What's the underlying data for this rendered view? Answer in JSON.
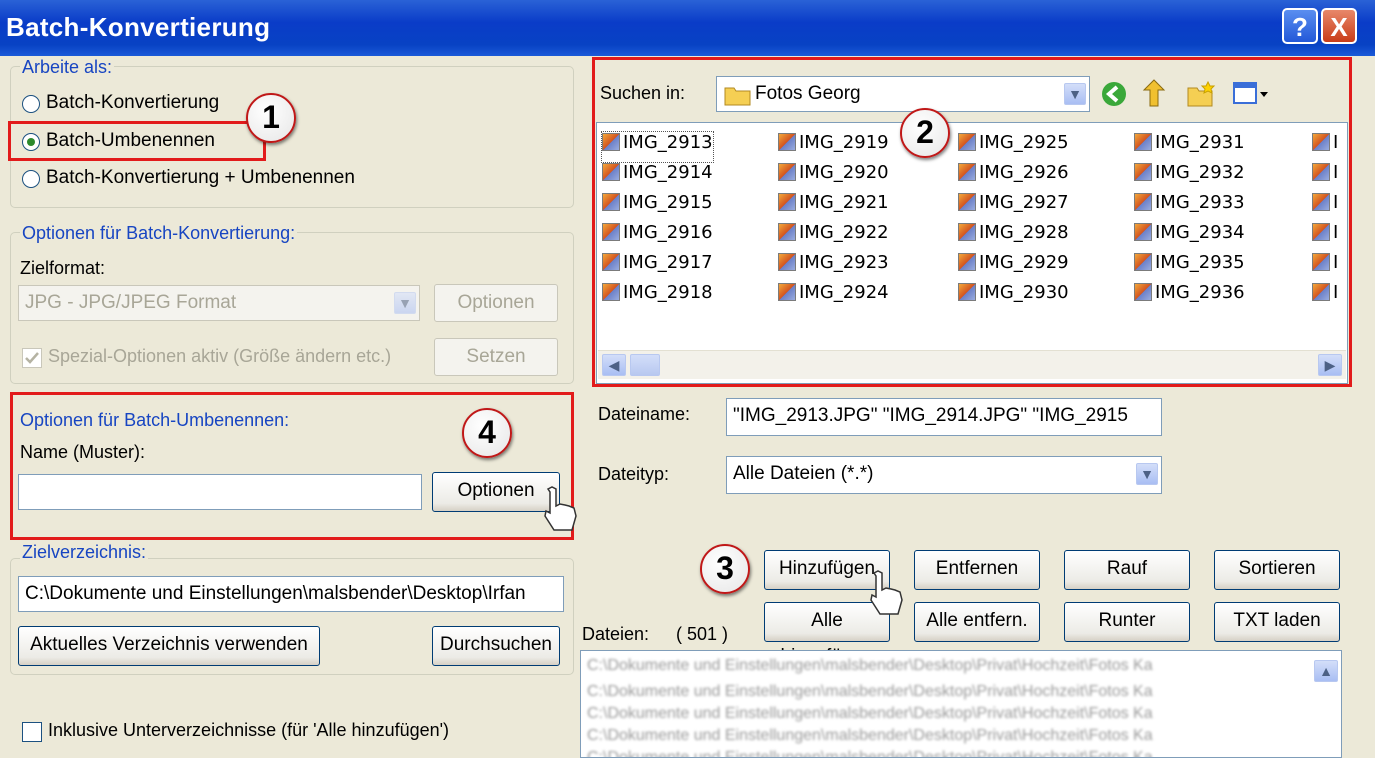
{
  "window": {
    "title": "Batch-Konvertierung",
    "help_label": "?",
    "close_label": "X"
  },
  "mode_group": {
    "label": "Arbeite als:",
    "options": [
      "Batch-Konvertierung",
      "Batch-Umbenennen",
      "Batch-Konvertierung + Umbenennen"
    ],
    "selected_index": 1
  },
  "convert_options": {
    "label": "Optionen für Batch-Konvertierung:",
    "format_label": "Zielformat:",
    "format_value": "JPG - JPG/JPEG Format",
    "options_button": "Optionen",
    "special_checkbox": "Spezial-Optionen aktiv (Größe ändern etc.)",
    "set_button": "Setzen"
  },
  "rename_options": {
    "label": "Optionen für Batch-Umbenennen:",
    "name_label": "Name (Muster):",
    "name_value": "",
    "options_button": "Optionen"
  },
  "target_dir": {
    "label": "Zielverzeichnis:",
    "path": "C:\\Dokumente und Einstellungen\\malsbender\\Desktop\\Irfan",
    "use_current_button": "Aktuelles Verzeichnis verwenden",
    "browse_button": "Durchsuchen"
  },
  "subdirs_checkbox": "Inklusive Unterverzeichnisse (für 'Alle hinzufügen')",
  "browser": {
    "search_in_label": "Suchen in:",
    "folder": "Fotos Georg",
    "columns": [
      [
        "IMG_2913",
        "IMG_2914",
        "IMG_2915",
        "IMG_2916",
        "IMG_2917",
        "IMG_2918"
      ],
      [
        "IMG_2919",
        "IMG_2920",
        "IMG_2921",
        "IMG_2922",
        "IMG_2923",
        "IMG_2924"
      ],
      [
        "IMG_2925",
        "IMG_2926",
        "IMG_2927",
        "IMG_2928",
        "IMG_2929",
        "IMG_2930"
      ],
      [
        "IMG_2931",
        "IMG_2932",
        "IMG_2933",
        "IMG_2934",
        "IMG_2935",
        "IMG_2936"
      ],
      [
        "I",
        "I",
        "I",
        "I",
        "I",
        "I"
      ]
    ]
  },
  "filename": {
    "label": "Dateiname:",
    "value": "\"IMG_2913.JPG\" \"IMG_2914.JPG\" \"IMG_2915"
  },
  "filetype": {
    "label": "Dateityp:",
    "value": "Alle Dateien (*.*)"
  },
  "buttons": {
    "add": "Hinzufügen",
    "remove": "Entfernen",
    "up": "Rauf",
    "sort": "Sortieren",
    "add_all": "Alle hinzufügen",
    "remove_all": "Alle entfern.",
    "down": "Runter",
    "load_txt": "TXT laden"
  },
  "files": {
    "label": "Dateien:",
    "count": "( 501 )",
    "entries": [
      "C:\\Dokumente und Einstellungen\\malsbender\\Desktop\\Privat\\Hochzeit\\Fotos Ka",
      "C:\\Dokumente und Einstellungen\\malsbender\\Desktop\\Privat\\Hochzeit\\Fotos Ka",
      "C:\\Dokumente und Einstellungen\\malsbender\\Desktop\\Privat\\Hochzeit\\Fotos Ka",
      "C:\\Dokumente und Einstellungen\\malsbender\\Desktop\\Privat\\Hochzeit\\Fotos Ka",
      "C:\\Dokumente und Einstellungen\\malsbender\\Desktop\\Privat\\Hochzeit\\Fotos Ka"
    ]
  },
  "callouts": [
    "1",
    "2",
    "3",
    "4"
  ],
  "colors": {
    "highlight_border": "#e21b1b",
    "titlebar": "#0a3cc8",
    "group_label": "#1745c2"
  }
}
